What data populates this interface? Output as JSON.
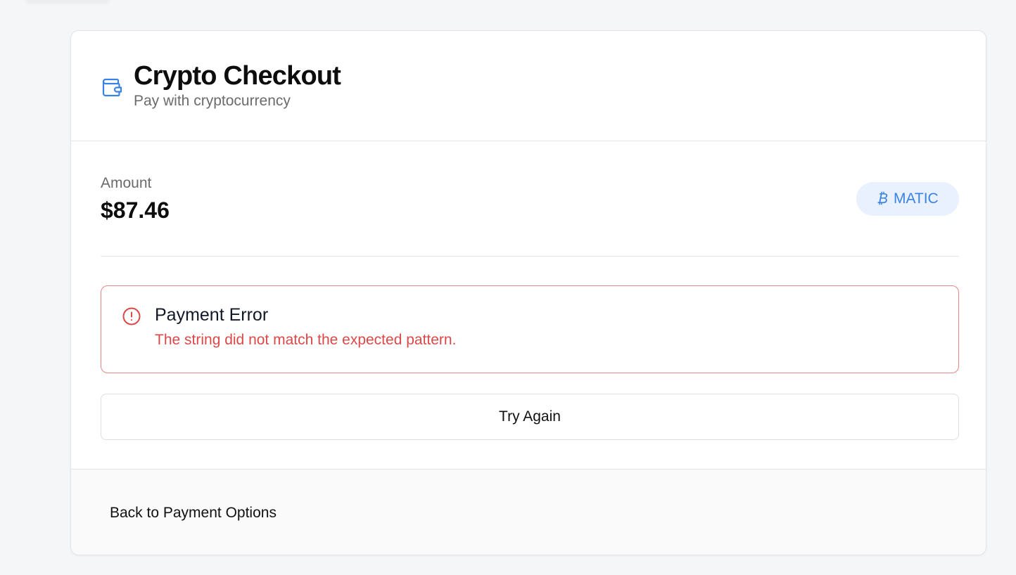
{
  "header": {
    "title": "Crypto Checkout",
    "subtitle": "Pay with cryptocurrency",
    "icon": "wallet-icon"
  },
  "amount": {
    "label": "Amount",
    "value": "$87.46"
  },
  "currency_badge": {
    "symbol": "₿",
    "label": "MATIC",
    "icon": "bitcoin-icon"
  },
  "error": {
    "title": "Payment Error",
    "message": "The string did not match the expected pattern.",
    "icon": "alert-circle-icon"
  },
  "actions": {
    "retry_label": "Try Again",
    "back_label": "Back to Payment Options"
  },
  "colors": {
    "accent": "#3a82e4",
    "badge_background": "#e8f1fd",
    "error": "#dc4848",
    "error_border": "#e88585"
  }
}
